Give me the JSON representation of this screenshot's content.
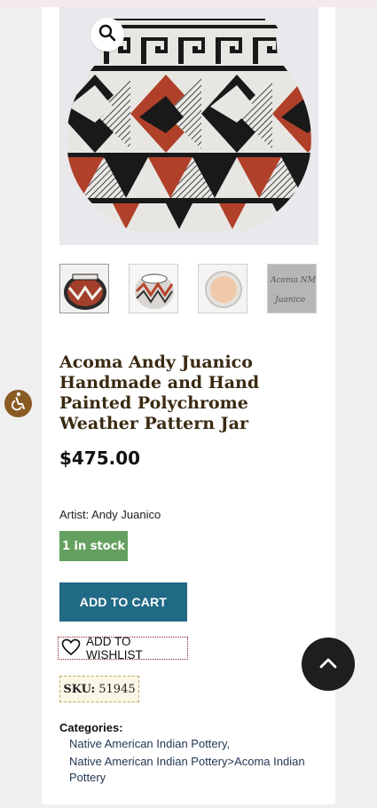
{
  "product": {
    "title": "Acoma Andy Juanico Handmade and Hand Painted Polychrome Weather Pattern Jar",
    "price": "$475.00",
    "artist_label": "Artist:",
    "artist_name": "Andy Juanico",
    "stock_status": "1 in stock",
    "add_to_cart_label": "ADD TO CART",
    "wishlist_label": "ADD TO WISHLIST",
    "sku_label": "SKU:",
    "sku_value": "51945",
    "categories_label": "Categories:",
    "categories": [
      "Native American Indian Pottery,",
      "Native American Indian Pottery>Acoma Indian Pottery"
    ]
  },
  "gallery": {
    "thumbnails": [
      "jar-front",
      "jar-top",
      "jar-bottom",
      "signature"
    ],
    "thumb_signature_text": "Acoma NM Juanico",
    "zoom_icon": "search-icon"
  },
  "colors": {
    "accent_cart": "#206a85",
    "stock_green": "#64a160",
    "title_brown": "#3a2a12",
    "pottery_red": "#b8432b"
  },
  "icons": {
    "accessibility": "accessibility-icon",
    "back_to_top": "chevron-up-icon",
    "wishlist": "heart-icon"
  }
}
